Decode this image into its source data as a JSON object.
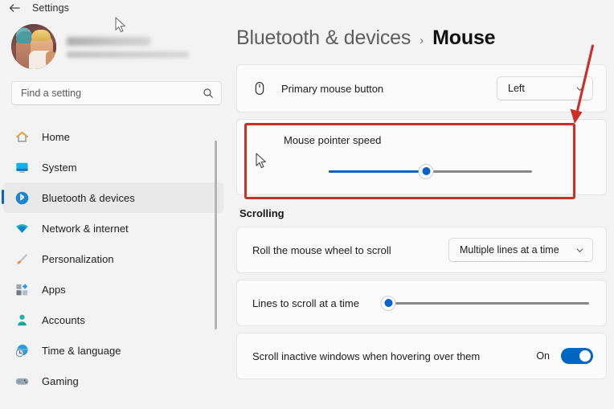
{
  "window": {
    "title": "Settings",
    "back_icon": "back-arrow-icon"
  },
  "account": {
    "name_redacted": "",
    "email_redacted": "",
    "avatar_icon": "user-avatar"
  },
  "search": {
    "placeholder": "Find a setting",
    "value": "",
    "icon": "search-icon"
  },
  "sidebar": {
    "items": [
      {
        "label": "Home",
        "icon": "home-icon",
        "selected": false
      },
      {
        "label": "System",
        "icon": "system-monitor-icon",
        "selected": false
      },
      {
        "label": "Bluetooth & devices",
        "icon": "bluetooth-icon",
        "selected": true
      },
      {
        "label": "Network & internet",
        "icon": "wifi-icon",
        "selected": false
      },
      {
        "label": "Personalization",
        "icon": "paintbrush-icon",
        "selected": false
      },
      {
        "label": "Apps",
        "icon": "apps-icon",
        "selected": false
      },
      {
        "label": "Accounts",
        "icon": "person-icon",
        "selected": false
      },
      {
        "label": "Time & language",
        "icon": "clock-globe-icon",
        "selected": false
      },
      {
        "label": "Gaming",
        "icon": "gamepad-icon",
        "selected": false
      }
    ]
  },
  "breadcrumb": {
    "parent": "Bluetooth & devices",
    "separator": "›",
    "current": "Mouse"
  },
  "settings": {
    "primary_mouse_button": {
      "label": "Primary mouse button",
      "icon": "mouse-icon",
      "value": "Left",
      "chevron": "chevron-down-icon"
    },
    "pointer_speed": {
      "label": "Mouse pointer speed",
      "slider_percent": 48
    },
    "scrolling_header": "Scrolling",
    "mouse_wheel": {
      "label": "Roll the mouse wheel to scroll",
      "value": "Multiple lines at a time",
      "chevron": "chevron-down-icon"
    },
    "lines_to_scroll": {
      "label": "Lines to scroll at a time",
      "slider_percent": 0
    },
    "scroll_inactive": {
      "label": "Scroll inactive windows when hovering over them",
      "state": "On",
      "enabled": true
    }
  },
  "annotation": {
    "highlight_color": "#cc2f27",
    "arrow_color": "#cc2f27",
    "target": "mouse-pointer-speed-card"
  },
  "colors": {
    "accent": "#0a62c9",
    "toggle_on": "#0067c0",
    "page_bg": "#f3f3f3",
    "card_bg": "#fbfbfb"
  }
}
